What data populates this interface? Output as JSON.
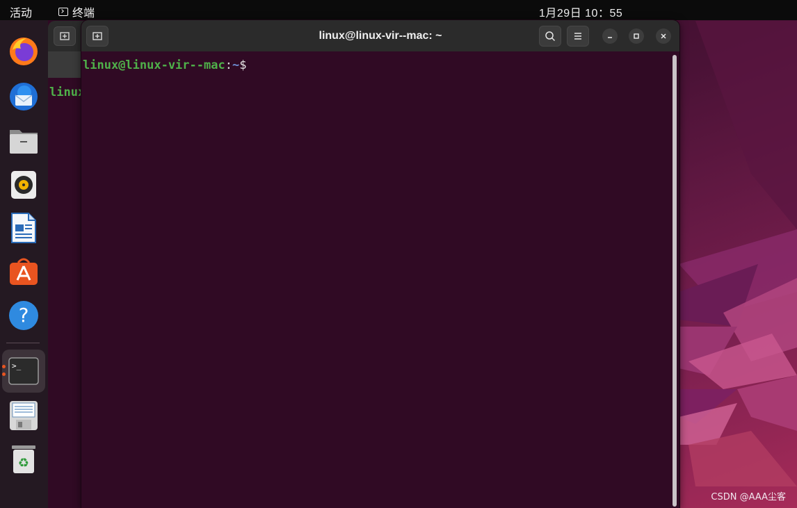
{
  "topbar": {
    "activities": "活动",
    "app_name": "终端",
    "clock": "1月29日  10：55"
  },
  "dock": {
    "items": [
      {
        "name": "firefox-icon"
      },
      {
        "name": "thunderbird-icon"
      },
      {
        "name": "files-icon"
      },
      {
        "name": "rhythmbox-icon"
      },
      {
        "name": "libreoffice-writer-icon"
      },
      {
        "name": "app-center-icon"
      },
      {
        "name": "help-icon"
      },
      {
        "name": "terminal-icon"
      },
      {
        "name": "save-drive-icon"
      },
      {
        "name": "trash-icon"
      }
    ],
    "active_item": "terminal-icon"
  },
  "background_window": {
    "prompt_fragment": "linux"
  },
  "terminal": {
    "title": "linux@linux-vir--mac: ~",
    "prompt": {
      "user_host": "linux@linux-vir--mac",
      "separator": ":",
      "path": "~",
      "symbol": "$"
    }
  },
  "watermark": "CSDN @AAA尘客",
  "colors": {
    "terminal_bg": "#300a24",
    "prompt_user": "#4fb14a",
    "prompt_path": "#6f8fd6",
    "accent": "#e95420"
  }
}
